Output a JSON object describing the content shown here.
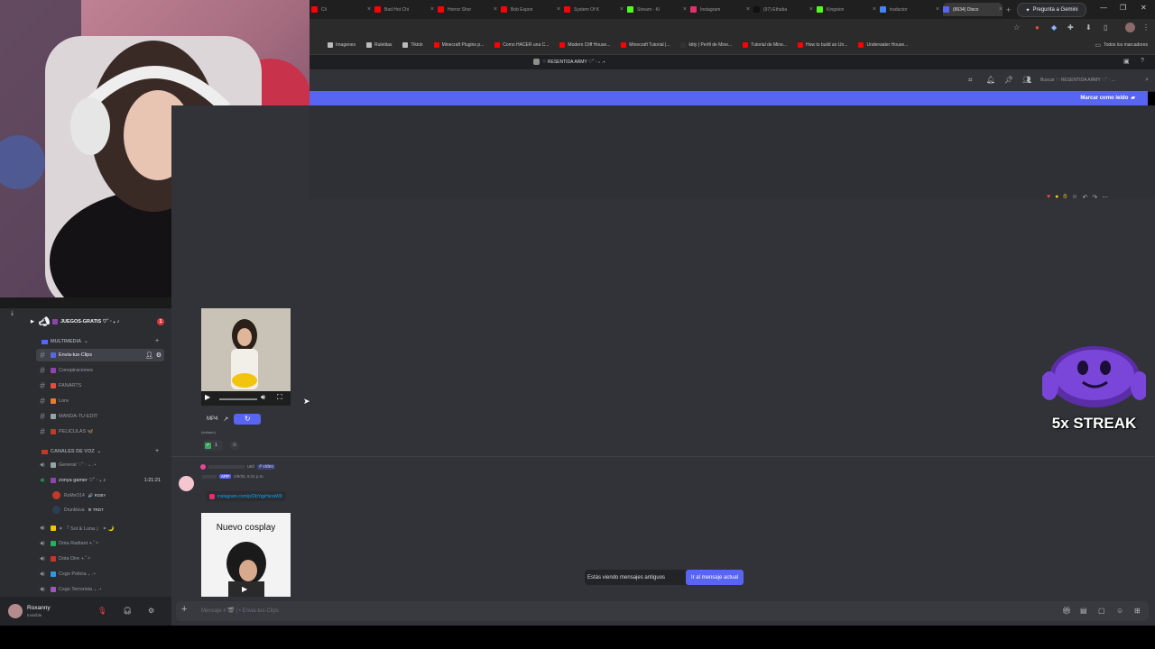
{
  "browser": {
    "tabs": [
      {
        "label": "Cli",
        "color": "#ff0000"
      },
      {
        "label": "Bad Hot Chi",
        "color": "#ff0000"
      },
      {
        "label": "Horror Shor",
        "color": "#ff0000"
      },
      {
        "label": "Bob Espon",
        "color": "#ff0000"
      },
      {
        "label": "System Of K",
        "color": "#ff0000"
      },
      {
        "label": "Stream - Ki",
        "color": "#53fc18"
      },
      {
        "label": "Instagram",
        "color": "#e1306c"
      },
      {
        "label": "(97) Ethaba",
        "color": "#111111"
      },
      {
        "label": "Kingston",
        "color": "#53fc18"
      },
      {
        "label": "traductor",
        "color": "#4285f4"
      },
      {
        "label": "(8634) Disco",
        "color": "#5865f2"
      }
    ],
    "new_tab": "+",
    "gemini_button": "Pregunta a Gemini",
    "bookmarks": [
      {
        "label": "Imagenes",
        "color": "#bbbbbb"
      },
      {
        "label": "Ruletitas",
        "color": "#bbbbbb"
      },
      {
        "label": "Tiktok",
        "color": "#bbbbbb"
      },
      {
        "label": "Minecraft Plugins p...",
        "color": "#ff0000"
      },
      {
        "label": "Como HACER una C...",
        "color": "#ff0000"
      },
      {
        "label": "Modern Cliff House...",
        "color": "#ff0000"
      },
      {
        "label": "Minecraft Tutorial |...",
        "color": "#ff0000"
      },
      {
        "label": "kitty | Perfil de Mine...",
        "color": "#333333"
      },
      {
        "label": "Tutorial de Mine...",
        "color": "#ff0000"
      },
      {
        "label": "How to build an Un...",
        "color": "#ff0000"
      },
      {
        "label": "Underwater House...",
        "color": "#ff0000"
      }
    ],
    "all_bookmarks": "Todos los marcadores"
  },
  "discord": {
    "server_title": "♡ RESENTIDA ARMY ♡˚ ‧ ₊ .⋆",
    "search_placeholder": "Buscar ♡ RESENTIDA ARMY ♡˚ ‧ ...",
    "mark_read": "Marcar como leído",
    "sidebar": {
      "top_channel": "JUEGOS-GRATIS ♡˚ ‧ ₊ ♪",
      "top_channel_badge": "1",
      "category_multimedia": "MULTIMEDIA",
      "text_channels": [
        {
          "label": "Envia-tus-Clips",
          "emoji_color": "#5865f2",
          "selected": true
        },
        {
          "label": "Conspiraciones",
          "emoji_color": "#8e44ad",
          "selected": false
        },
        {
          "label": "FANARTS",
          "emoji_color": "#e74c3c",
          "selected": false
        },
        {
          "label": "Lore",
          "emoji_color": "#e67e22",
          "selected": false
        },
        {
          "label": "MANDA-TU-EDIT",
          "emoji_color": "#95a5a6",
          "selected": false
        },
        {
          "label": "PELICULAS 🦋",
          "emoji_color": "#c0392b",
          "selected": false
        }
      ],
      "category_voice": "CANALES DE VOZ",
      "voice_channels": [
        {
          "label": "General ♡˚ ‧ ₊ .⋆",
          "emoji_color": "#95a5a6",
          "timer": ""
        },
        {
          "label": "zonya gamer ♡˚ ‧ ₊ ♪",
          "emoji_color": "#8e44ad",
          "timer": "1:21:21"
        }
      ],
      "voice_users": [
        {
          "name": "RoMeO14",
          "badge": "🔊 ROBY",
          "color": "#c0392b"
        },
        {
          "name": "Drunkluva",
          "badge": "⚙ TRDT",
          "color": "#2c3e50"
        }
      ],
      "more_voice_channels": [
        {
          "label": "✦ 『 Sol & Luna 』 ✦ 🌙",
          "emoji_color": "#f1c40f"
        },
        {
          "label": "Dota Radiant +.˚✧",
          "emoji_color": "#27ae60"
        },
        {
          "label": "Dota Dire +.˚✧",
          "emoji_color": "#c0392b"
        },
        {
          "label": "Csgo Policia ₊ .⋆",
          "emoji_color": "#3498db"
        },
        {
          "label": "Csgo Terrorista ₊ .⋆",
          "emoji_color": "#9b59b6"
        }
      ]
    },
    "user": {
      "name": "Roxanny",
      "status": "Invisible"
    },
    "messages": {
      "media_format": "MP4",
      "edited": "(editado)",
      "reaction_count": "1",
      "bot_author_tag": "usó",
      "bot_command": "# video",
      "bot_app_tag": "APP",
      "bot_timestamp": "2/9/25, 5:21 p.m.",
      "instagram_link": "instagram.com/p/DbYqpHeraW9",
      "video_caption": "Nuevo cosplay"
    },
    "old_messages_notice": "Estás viendo mensajes antiguos",
    "jump_button": "Ir al mensaje actual",
    "composer_placeholder": "Mensaje # 🎬 | • Envia-tus-Clips"
  },
  "overlay": {
    "streak_text": "5x STREAK"
  },
  "icons": [
    "close-icon",
    "plus-icon",
    "hash-icon",
    "speaker-icon",
    "gear-icon",
    "microphone-icon",
    "headphones-icon",
    "bell-icon",
    "pin-icon",
    "members-icon",
    "search-icon",
    "play-icon",
    "volume-icon",
    "fullscreen-icon",
    "refresh-icon",
    "gift-icon",
    "gif-icon",
    "sticker-icon",
    "emoji-icon",
    "apps-icon"
  ]
}
